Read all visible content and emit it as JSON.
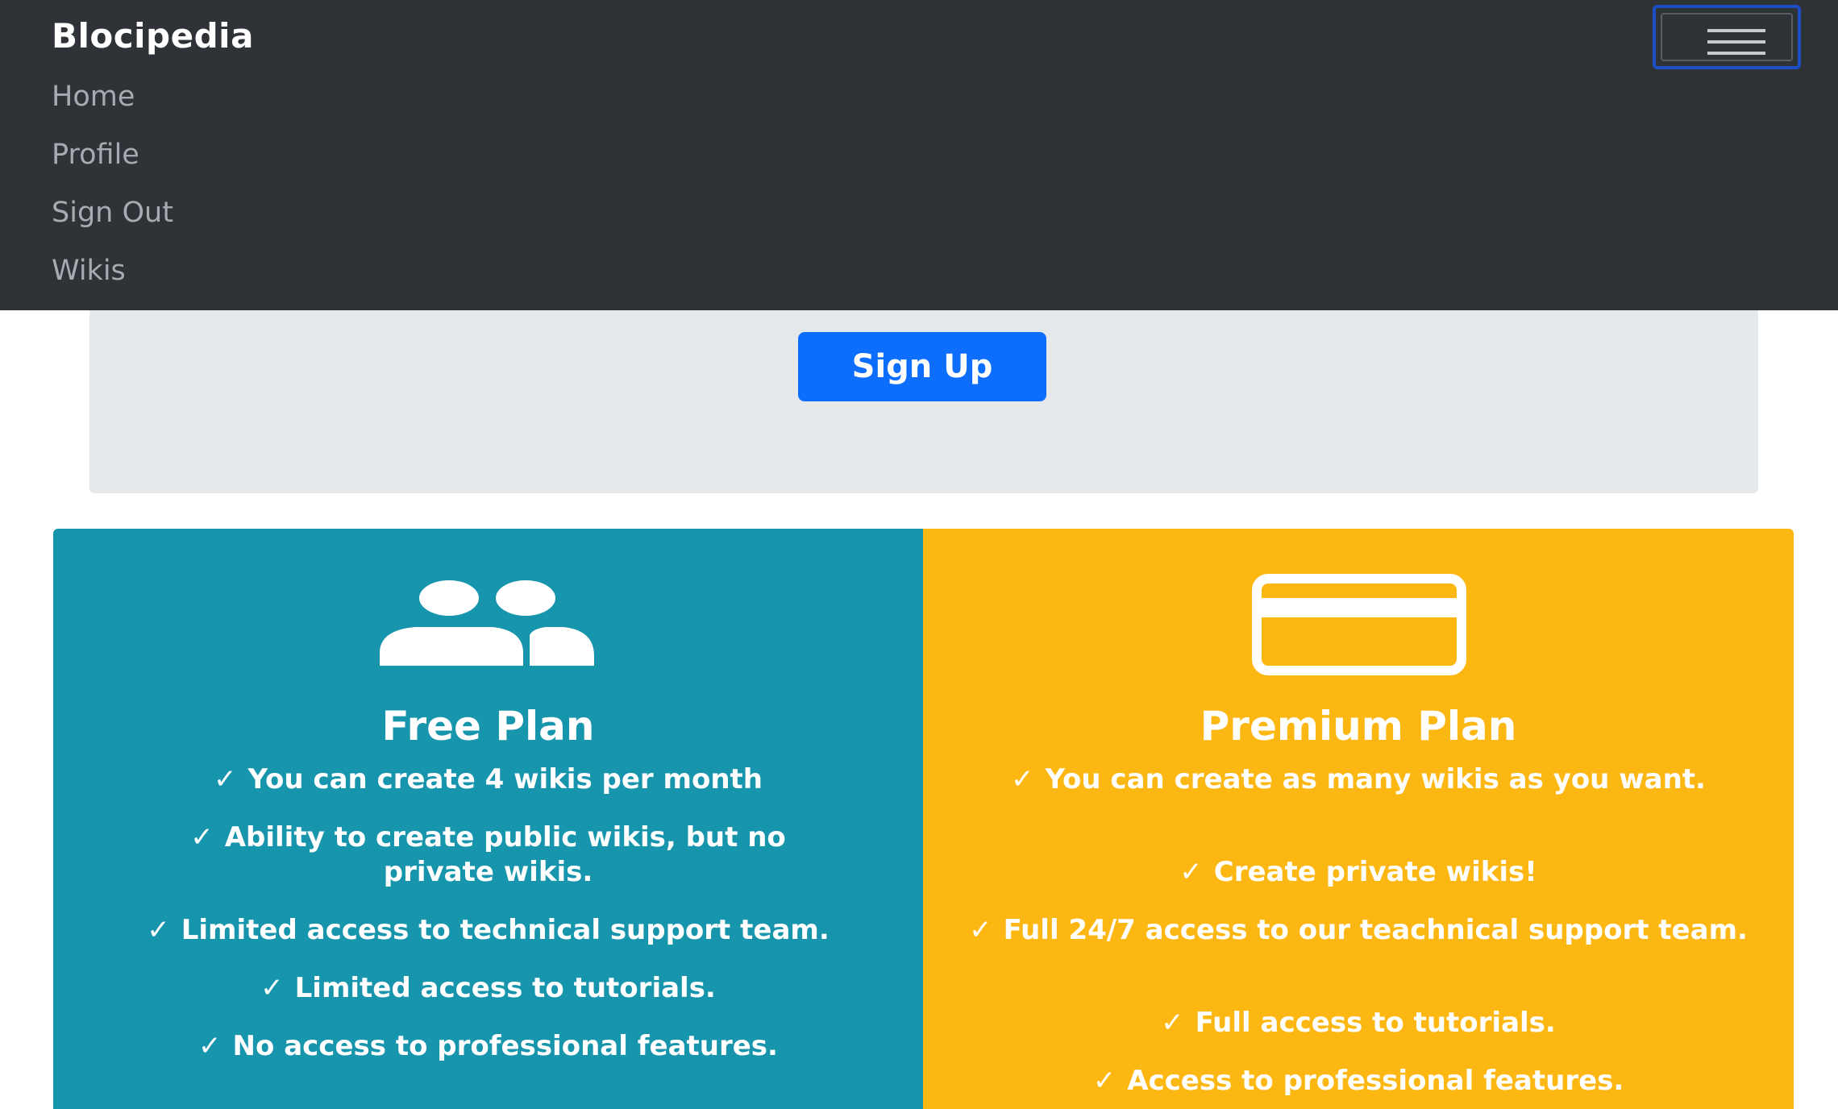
{
  "navbar": {
    "brand": "Blocipedia",
    "links": [
      "Home",
      "Profile",
      "Sign Out",
      "Wikis"
    ],
    "toggler_icon": "hamburger-menu-icon"
  },
  "jumbotron": {
    "signup_label": "Sign Up"
  },
  "plans": {
    "free": {
      "icon": "users-icon",
      "title": "Free Plan",
      "features": [
        "You can create 4 wikis per month",
        "Ability to create public wikis, but no private wikis.",
        "Limited access to technical support team.",
        "Limited access to tutorials.",
        "No access to professional features."
      ]
    },
    "premium": {
      "icon": "credit-card-icon",
      "title": "Premium Plan",
      "features": [
        "You can create as many wikis as you want.",
        "Create private wikis!",
        "Full 24/7 access to our teachnical support team.",
        "Full access to tutorials.",
        "Access to professional features."
      ]
    }
  },
  "colors": {
    "navbar": "#2f3237",
    "primary": "#0d6efd",
    "free_plan": "#1795ac",
    "premium_plan": "#fdb712"
  }
}
